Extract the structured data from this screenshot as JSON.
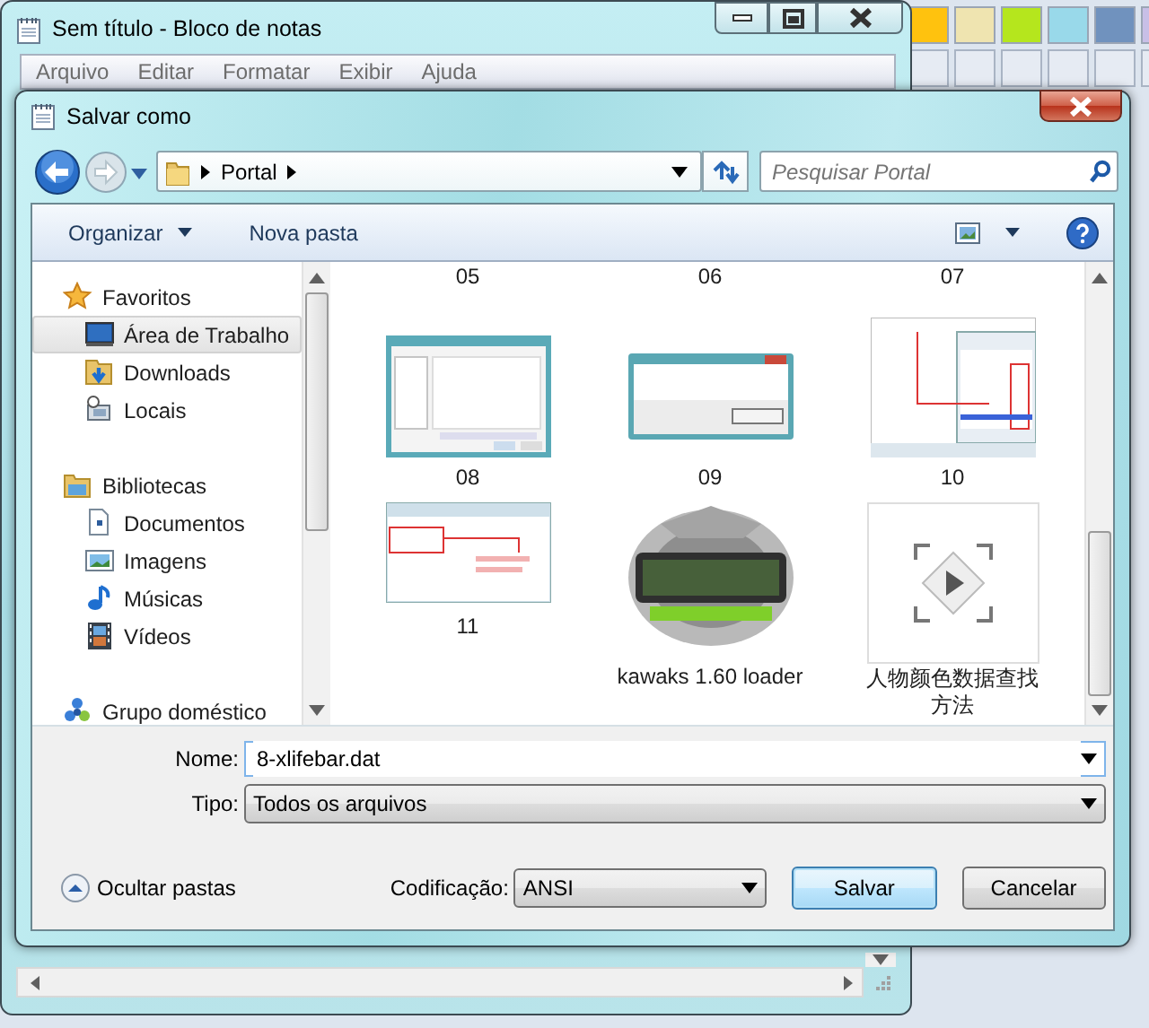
{
  "notepad": {
    "title": "Sem título - Bloco de notas",
    "menu": [
      "Arquivo",
      "Editar",
      "Formatar",
      "Exibir",
      "Ajuda"
    ]
  },
  "dialog": {
    "title": "Salvar como",
    "address": {
      "crumbs": [
        "Portal"
      ]
    },
    "search": {
      "placeholder": "Pesquisar Portal"
    },
    "toolbar": {
      "organize": "Organizar",
      "new_folder": "Nova pasta"
    },
    "nav_pane": [
      {
        "label": "Favoritos",
        "kind": "favorites",
        "selected": false,
        "children": [
          {
            "label": "Área de Trabalho",
            "kind": "desktop",
            "selected": true
          },
          {
            "label": "Downloads",
            "kind": "downloads",
            "selected": false
          },
          {
            "label": "Locais",
            "kind": "places",
            "selected": false
          }
        ]
      },
      {
        "label": "Bibliotecas",
        "kind": "libraries",
        "selected": false,
        "children": [
          {
            "label": "Documentos",
            "kind": "documents",
            "selected": false
          },
          {
            "label": "Imagens",
            "kind": "pictures",
            "selected": false
          },
          {
            "label": "Músicas",
            "kind": "music",
            "selected": false
          },
          {
            "label": "Vídeos",
            "kind": "videos",
            "selected": false
          }
        ]
      },
      {
        "label": "Grupo doméstico",
        "kind": "homegroup",
        "selected": false
      }
    ],
    "files": [
      {
        "name": "05",
        "kind": "cut"
      },
      {
        "name": "06",
        "kind": "cut"
      },
      {
        "name": "07",
        "kind": "cut"
      },
      {
        "name": "08",
        "kind": "picture"
      },
      {
        "name": "09",
        "kind": "picture"
      },
      {
        "name": "10",
        "kind": "picture"
      },
      {
        "name": "11",
        "kind": "picture"
      },
      {
        "name": "kawaks 1.60 loader",
        "kind": "picture"
      },
      {
        "name": "人物颜色数据查找方法",
        "kind": "video"
      }
    ],
    "name_field": {
      "label": "Nome:",
      "value": "8-xlifebar.dat"
    },
    "type_field": {
      "label": "Tipo:",
      "value": "Todos os arquivos"
    },
    "hide_folders": "Ocultar pastas",
    "encoding": {
      "label": "Codificação:",
      "value": "ANSI"
    },
    "buttons": [
      "Salvar",
      "Cancelar"
    ]
  }
}
